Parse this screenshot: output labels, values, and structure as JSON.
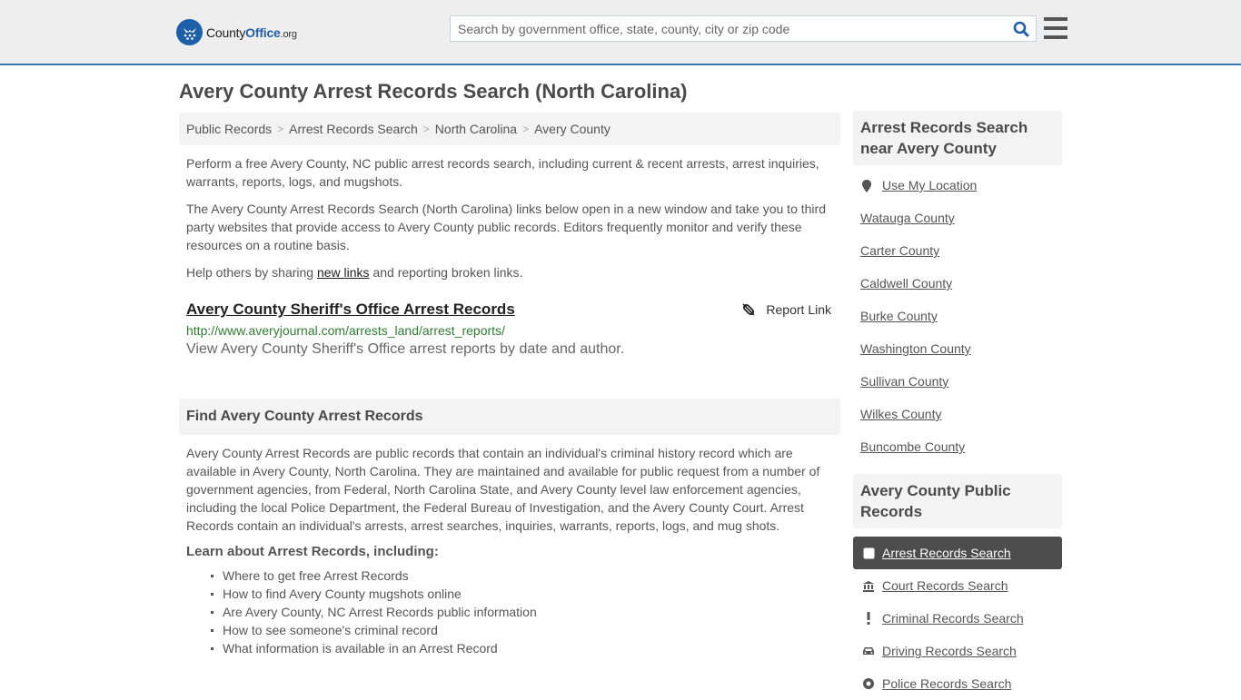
{
  "header": {
    "logo": {
      "county": "County",
      "office": "Office",
      "org": ".org"
    },
    "search_placeholder": "Search by government office, state, county, city or zip code",
    "search_value": ""
  },
  "page_title": "Avery County Arrest Records Search (North Carolina)",
  "breadcrumb": [
    "Public Records",
    "Arrest Records Search",
    "North Carolina",
    "Avery County"
  ],
  "intro": {
    "p1": "Perform a free Avery County, NC public arrest records search, including current & recent arrests, arrest inquiries, warrants, reports, logs, and mugshots.",
    "p2": "The Avery County Arrest Records Search (North Carolina) links below open in a new window and take you to third party websites that provide access to Avery County public records. Editors frequently monitor and verify these resources on a routine basis.",
    "p3_before": "Help others by sharing ",
    "p3_link": "new links",
    "p3_after": " and reporting broken links."
  },
  "listing": {
    "title": "Avery County Sheriff's Office Arrest Records",
    "url": "http://www.averyjournal.com/arrests_land/arrest_reports/",
    "description": "View Avery County Sheriff's Office arrest reports by date and author.",
    "report_label": "Report Link"
  },
  "find_section": {
    "heading": "Find Avery County Arrest Records",
    "body": "Avery County Arrest Records are public records that contain an individual's criminal history record which are available in Avery County, North Carolina. They are maintained and available for public request from a number of government agencies, from Federal, North Carolina State, and Avery County level law enforcement agencies, including the local Police Department, the Federal Bureau of Investigation, and the Avery County Court. Arrest Records contain an individual's arrests, arrest searches, inquiries, warrants, reports, logs, and mug shots.",
    "learn_heading": "Learn about Arrest Records, including:",
    "learn_items": [
      "Where to get free Arrest Records",
      "How to find Avery County mugshots online",
      "Are Avery County, NC Arrest Records public information",
      "How to see someone's criminal record",
      "What information is available in an Arrest Record"
    ]
  },
  "sidebar": {
    "nearby_heading": "Arrest Records Search near Avery County",
    "use_location": "Use My Location",
    "nearby": [
      "Watauga County",
      "Carter County",
      "Caldwell County",
      "Burke County",
      "Washington County",
      "Sullivan County",
      "Wilkes County",
      "Buncombe County"
    ],
    "public_heading": "Avery County Public Records",
    "public_records": [
      {
        "label": "Arrest Records Search",
        "icon": "square-icon",
        "active": true
      },
      {
        "label": "Court Records Search",
        "icon": "courthouse-icon",
        "active": false
      },
      {
        "label": "Criminal Records Search",
        "icon": "exclamation-icon",
        "active": false
      },
      {
        "label": "Driving Records Search",
        "icon": "car-icon",
        "active": false
      },
      {
        "label": "Police Records Search",
        "icon": "police-icon",
        "active": false
      }
    ]
  },
  "colors": {
    "brand": "#1d5fa8",
    "header_border": "#3a7caf",
    "url_green": "#2e7d32",
    "active_bg": "#4d4d4d"
  }
}
